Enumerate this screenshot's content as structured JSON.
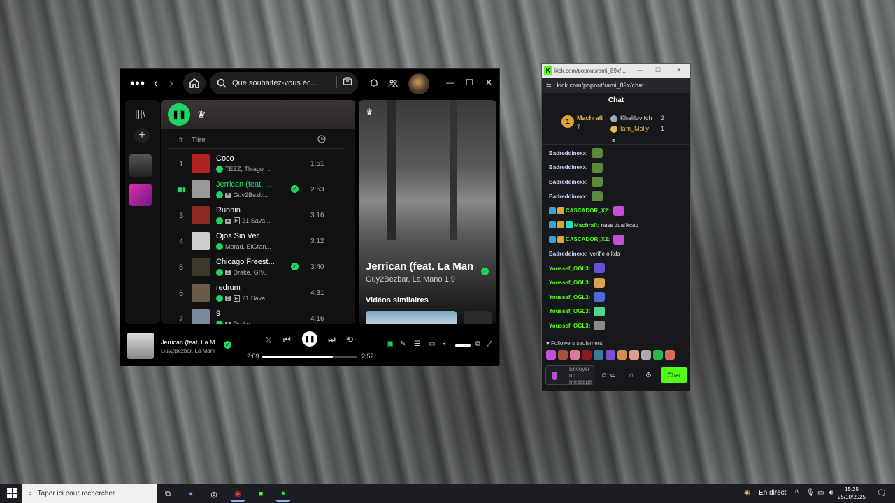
{
  "spotify": {
    "search_placeholder": "Que souhaitez-vous éc...",
    "col_hash": "#",
    "col_title": "Titre",
    "tracks": [
      {
        "num": "1",
        "name": "Coco",
        "meta": "TEZZ, Thiago ...",
        "explicit": false,
        "video": false,
        "liked": false,
        "duration": "1:51",
        "color": "#b32222"
      },
      {
        "num": "▮▮▮",
        "name": "Jerrican (feat. ...",
        "meta": "Guy2Bezb...",
        "explicit": true,
        "video": false,
        "liked": true,
        "duration": "2:53",
        "color": "#9a9a9a"
      },
      {
        "num": "3",
        "name": "Runnin",
        "meta": "21 Sava...",
        "explicit": true,
        "video": true,
        "liked": false,
        "duration": "3:16",
        "color": "#8a2a1e"
      },
      {
        "num": "4",
        "name": "Ojos Sin Ver",
        "meta": "Morad, ElGran...",
        "explicit": false,
        "video": false,
        "liked": false,
        "duration": "3:12",
        "color": "#cfcfcf"
      },
      {
        "num": "5",
        "name": "Chicago Freest...",
        "meta": "Drake, GIV...",
        "explicit": true,
        "video": false,
        "liked": true,
        "duration": "3:40",
        "color": "#3b3a2a"
      },
      {
        "num": "6",
        "name": "redrum",
        "meta": "21 Sava...",
        "explicit": true,
        "video": true,
        "liked": false,
        "duration": "4:31",
        "color": "#6a5a4a"
      },
      {
        "num": "7",
        "name": "9",
        "meta": "Drake",
        "explicit": true,
        "video": false,
        "liked": false,
        "duration": "4:16",
        "color": "#7a8a9a"
      }
    ],
    "now_playing": {
      "title": "Jerrican (feat. La Man",
      "artist": "Guy2Bezbar, La Mano 1.9",
      "videos_label": "Vidéos similaires"
    },
    "player": {
      "title": "Jerrican (feat. La M",
      "artist": "Guy2Bezbar, La Mano",
      "elapsed": "2:09",
      "total": "2:52",
      "progress": 0.75
    }
  },
  "kick": {
    "title_url": "kick.com/popout/rami_89x/...",
    "address": "kick.com/popout/rami_89x/chat",
    "header": "Chat",
    "leaders": {
      "first": {
        "rank": "1",
        "name": "Machrafi",
        "count": "7"
      },
      "second": {
        "name": "Khalilovitch",
        "count": "2"
      },
      "third": {
        "name": "Iam_Molly",
        "count": "1"
      }
    },
    "messages": [
      {
        "user": "Badreddinexx:",
        "text": "",
        "color": "#c8d2ff",
        "emote": "#5c8a3a",
        "badges": 0
      },
      {
        "user": "Badreddinexx:",
        "text": "",
        "color": "#c8d2ff",
        "emote": "#5c8a3a",
        "badges": 0
      },
      {
        "user": "Badreddinexx:",
        "text": "",
        "color": "#c8d2ff",
        "emote": "#5c8a3a",
        "badges": 0
      },
      {
        "user": "Badreddinexx:",
        "text": "",
        "color": "#c8d2ff",
        "emote": "#5c8a3a",
        "badges": 0
      },
      {
        "user": "CASCADOR_X2:",
        "text": "",
        "color": "#53fc18",
        "emote": "#c14fd8",
        "badges": 2
      },
      {
        "user": "Machrafi:",
        "text": "nass dual kcap",
        "color": "#53fc18",
        "emote": "",
        "badges": 3
      },
      {
        "user": "CASCADOR_X2:",
        "text": "",
        "color": "#53fc18",
        "emote": "#c14fd8",
        "badges": 2
      },
      {
        "user": "Badreddinexx:",
        "text": "verifie o kda",
        "color": "#c8d2ff",
        "emote": "",
        "badges": 0
      },
      {
        "user": "Youssef_OGL3:",
        "text": "",
        "color": "#53fc18",
        "emote": "#6a4fd8",
        "badges": 0
      },
      {
        "user": "Youssef_OGL3:",
        "text": "",
        "color": "#53fc18",
        "emote": "#d8a04f",
        "badges": 0
      },
      {
        "user": "Youssef_OGL3:",
        "text": "",
        "color": "#53fc18",
        "emote": "#4f6ad8",
        "badges": 0
      },
      {
        "user": "Youssef_OGL3:",
        "text": "",
        "color": "#53fc18",
        "emote": "#4fd88a",
        "badges": 0
      },
      {
        "user": "Youssef_OGL3:",
        "text": "",
        "color": "#53fc18",
        "emote": "#8a8a8a",
        "badges": 0
      }
    ],
    "followers_only": "Followers seulement",
    "input_placeholder": "Envoyer un message",
    "send_label": "Chat"
  },
  "taskbar": {
    "search_placeholder": "Taper ici pour rechercher",
    "live_label": "En direct",
    "time": "15:25",
    "date": "25/10/2025"
  }
}
